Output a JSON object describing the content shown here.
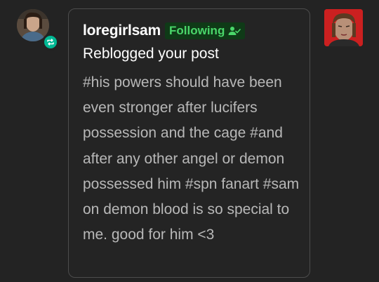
{
  "notification": {
    "username": "loregirlsam",
    "follow_status": "Following",
    "action": "Reblogged your post",
    "tags": "#his powers should have been even stronger after lucifers possession and the cage #and after any other angel or demon possessed him #spn fanart #sam on demon blood is so special to me. good for him <3"
  },
  "icons": {
    "reblog_badge": "reblog-icon",
    "follow_check": "user-check-icon"
  },
  "colors": {
    "background": "#232323",
    "card_border": "#4d4d4d",
    "reblog_badge": "#00b894",
    "following_text": "#4ad66a",
    "following_bg": "#0f3a17"
  }
}
